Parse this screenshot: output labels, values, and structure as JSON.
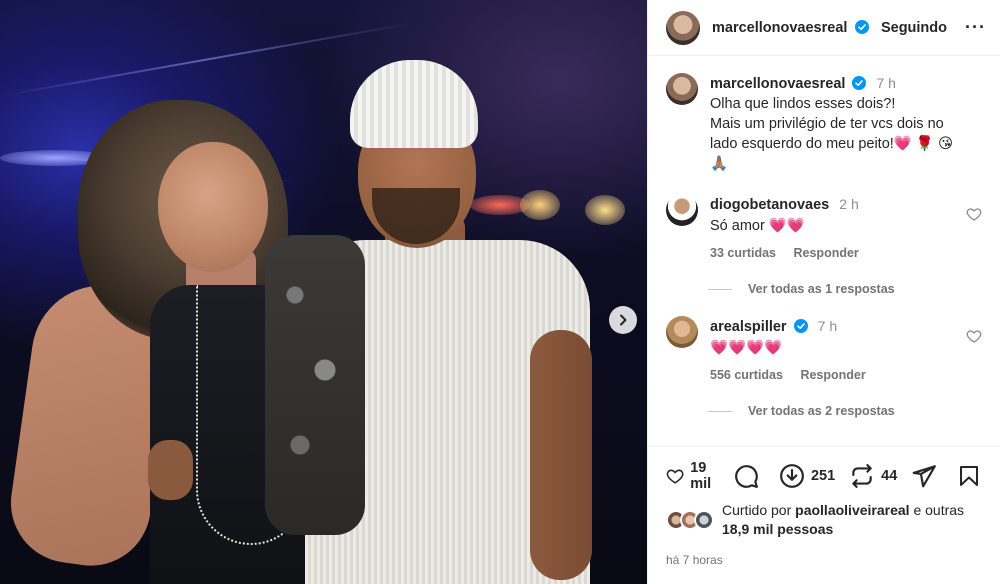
{
  "post": {
    "author": "marcellonovaesreal",
    "follow_status": "Seguindo",
    "more_icon": "more-horizontal-icon",
    "caption": {
      "author": "marcellonovaesreal",
      "time": "7 h",
      "lines": [
        "Olha que lindos esses dois?!",
        "Mais um privilégio de ter vcs dois no",
        "lado esquerdo do meu peito!💗 🌹 😘"
      ],
      "last_line": "🙏🏽"
    }
  },
  "comments": [
    {
      "author": "diogobetanovaes",
      "time": "2 h",
      "verified": false,
      "text": "Só amor 💗💗",
      "likes": "33 curtidas",
      "reply": "Responder",
      "view_replies": "Ver todas as 1 respostas"
    },
    {
      "author": "arealspiller",
      "time": "7 h",
      "verified": true,
      "text": "💗💗💗💗",
      "likes": "556 curtidas",
      "reply": "Responder",
      "view_replies": "Ver todas as 2 respostas"
    }
  ],
  "actions": {
    "likes": "19 mil",
    "reposts_count": "251",
    "shares": "44"
  },
  "liked_by": {
    "prefix": "Curtido por",
    "user": "paollaoliveirareal",
    "conj": "e outras",
    "others": "18,9 mil pessoas"
  },
  "posted_ago": "há 7 horas",
  "colors": {
    "verified": "#0095f6",
    "heart": "#ed2e50",
    "text": "#262626",
    "muted": "#737373"
  }
}
